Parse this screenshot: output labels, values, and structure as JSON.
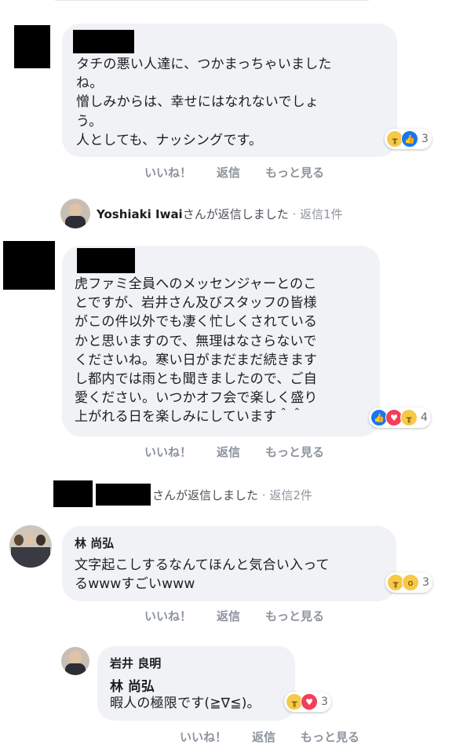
{
  "comments": [
    {
      "lines": [
        "タチの悪い人達に、つかまっちゃいました",
        "ね。",
        "憎しみからは、幸せにはなれないでしょ",
        "う。",
        "人としても、ナッシングです。"
      ],
      "reaction_count": "3"
    },
    {
      "lines": [
        "虎ファミ全員へのメッセンジャーとのこ",
        "とですが、岩井さん及びスタッフの皆様",
        "がこの件以外でも凄く忙しくされている",
        "かと思いますので、無理はなさらないで",
        "くださいね。寒い日がまだまだ続きます",
        "し都内では雨とも聞きましたので、ご自",
        "愛ください。いつかオフ会で楽しく盛り",
        "上がれる日を楽しみにしています＾＾"
      ],
      "reaction_count": "4"
    },
    {
      "author": "林 尚弘",
      "lines": [
        "文字起こしするなんてほんと気合い入って",
        "るwwwすごいwww"
      ],
      "reaction_count": "3"
    },
    {
      "author": "岩井 良明",
      "mention": "林 尚弘",
      "lines": [
        "暇人の極限です(≧∇≦)。"
      ],
      "reaction_count": "3"
    }
  ],
  "actions": {
    "like": "いいね！",
    "reply": "返信",
    "more": "もっと見る"
  },
  "reply_summaries": [
    {
      "name": "Yoshiaki Iwai",
      "suffix": "さんが返信しました",
      "meta": "· 返信1件"
    },
    {
      "suffix": "さんが返信しました",
      "meta": "· 返信2件"
    }
  ],
  "icons": {
    "sad": "sad-reaction-icon",
    "like": "like-reaction-icon",
    "love": "love-reaction-icon",
    "wow": "wow-reaction-icon"
  },
  "colors": {
    "bubble": "#f0f2f5",
    "meta": "#8d949e",
    "like": "#1877f2",
    "love": "#f33e58",
    "sad": "#f7c948"
  }
}
